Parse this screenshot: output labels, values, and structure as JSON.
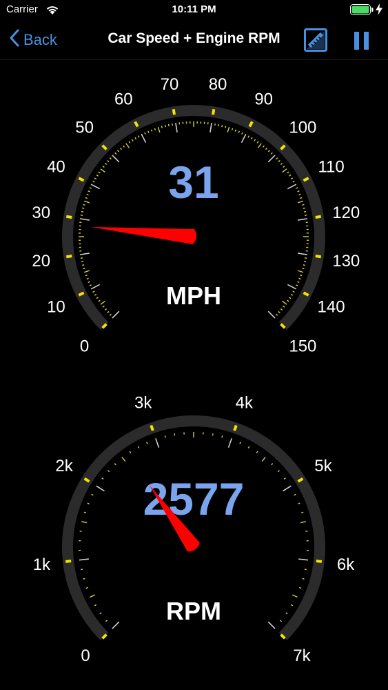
{
  "status_bar": {
    "carrier": "Carrier",
    "time": "10:11 PM",
    "wifi_icon": "wifi-icon",
    "battery_icon": "battery-icon",
    "charging_icon": "charging-bolt-icon"
  },
  "nav": {
    "back_label": "Back",
    "title": "Car Speed + Engine RPM",
    "ruler_icon": "ruler-icon",
    "pause_icon": "pause-icon"
  },
  "colors": {
    "accent": "#4a90e2",
    "tick_major": "#f5e400",
    "tick_minor": "#d8d230",
    "needle": "#ff0000",
    "value_text": "#7aa5ee",
    "track": "#2b2b2b"
  },
  "speed_gauge": {
    "value": 31,
    "value_text": "31",
    "unit": "MPH",
    "min": 0,
    "max": 150,
    "labels": [
      "0",
      "10",
      "20",
      "30",
      "40",
      "50",
      "60",
      "70",
      "80",
      "90",
      "100",
      "110",
      "120",
      "130",
      "140",
      "150"
    ],
    "needle_value": 28
  },
  "rpm_gauge": {
    "value": 2577,
    "value_text": "2577",
    "unit": "RPM",
    "min": 0,
    "max": 7000,
    "labels": [
      "0",
      "1k",
      "2k",
      "3k",
      "4k",
      "5k",
      "6k",
      "7k"
    ],
    "needle_value": 2577
  }
}
